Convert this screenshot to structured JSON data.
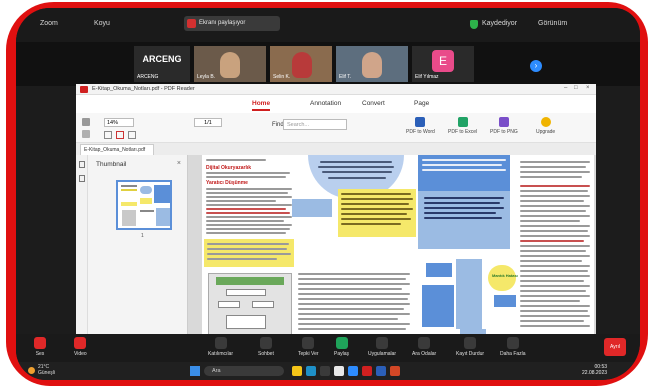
{
  "zoom_top": {
    "app_label": "Zoom",
    "view_label": "Koyu",
    "share_title": "Ekranı paylaşıyor",
    "recording": "Kaydediyor",
    "view_mode": "Görünüm"
  },
  "participants": [
    {
      "name": "ARCENG",
      "big": "ARCENG",
      "type": "text"
    },
    {
      "name": "Leyla B.",
      "type": "video",
      "bg": "#6b5a4a",
      "face": "#c9a27e"
    },
    {
      "name": "Selin K.",
      "type": "video",
      "bg": "#8a6b4e",
      "face": "#b83a3a"
    },
    {
      "name": "Elif T.",
      "type": "video",
      "bg": "#5d6e7e",
      "face": "#d0a58a"
    },
    {
      "name": "Elif Yılmaz",
      "type": "avatar",
      "initial": "E"
    }
  ],
  "pdf": {
    "title": "E-Kitap_Okuma_Notları.pdf - PDF Reader",
    "menu": [
      "Home",
      "Annotation",
      "Convert",
      "Page"
    ],
    "active_menu": "Home",
    "zoom": "14%",
    "page": "1/1",
    "find_label": "Find",
    "search_placeholder": "Search...",
    "tools": [
      {
        "label": "PDF to Word",
        "color": "#2b5fb8"
      },
      {
        "label": "PDF to Excel",
        "color": "#21a366"
      },
      {
        "label": "PDF to PNG",
        "color": "#7a4fc9"
      },
      {
        "label": "Upgrade",
        "color": "#f0b400"
      }
    ],
    "tab_name": "E-Kitap_Okuma_Notları.pdf",
    "thumbnail_label": "Thumbnail",
    "thumbnail_page": "1",
    "headings": {
      "left1": "Dijital Okuryazarlık",
      "left2": "Yaratıcı Düşünme",
      "green": "Mantık Hatası"
    }
  },
  "zoom_bottom": {
    "buttons": [
      "Ses",
      "Video",
      "Katılımcılar",
      "Sohbet",
      "Tepki Ver",
      "Paylaş",
      "Uygulamalar",
      "Ara Odalar",
      "Kayıt Durdur",
      "Daha Fazla"
    ],
    "end": "Ayrıl"
  },
  "taskbar": {
    "temp": "21°C",
    "weather": "Güneşli",
    "search": "Ara",
    "time": "00:53",
    "date": "22.08.2023"
  }
}
